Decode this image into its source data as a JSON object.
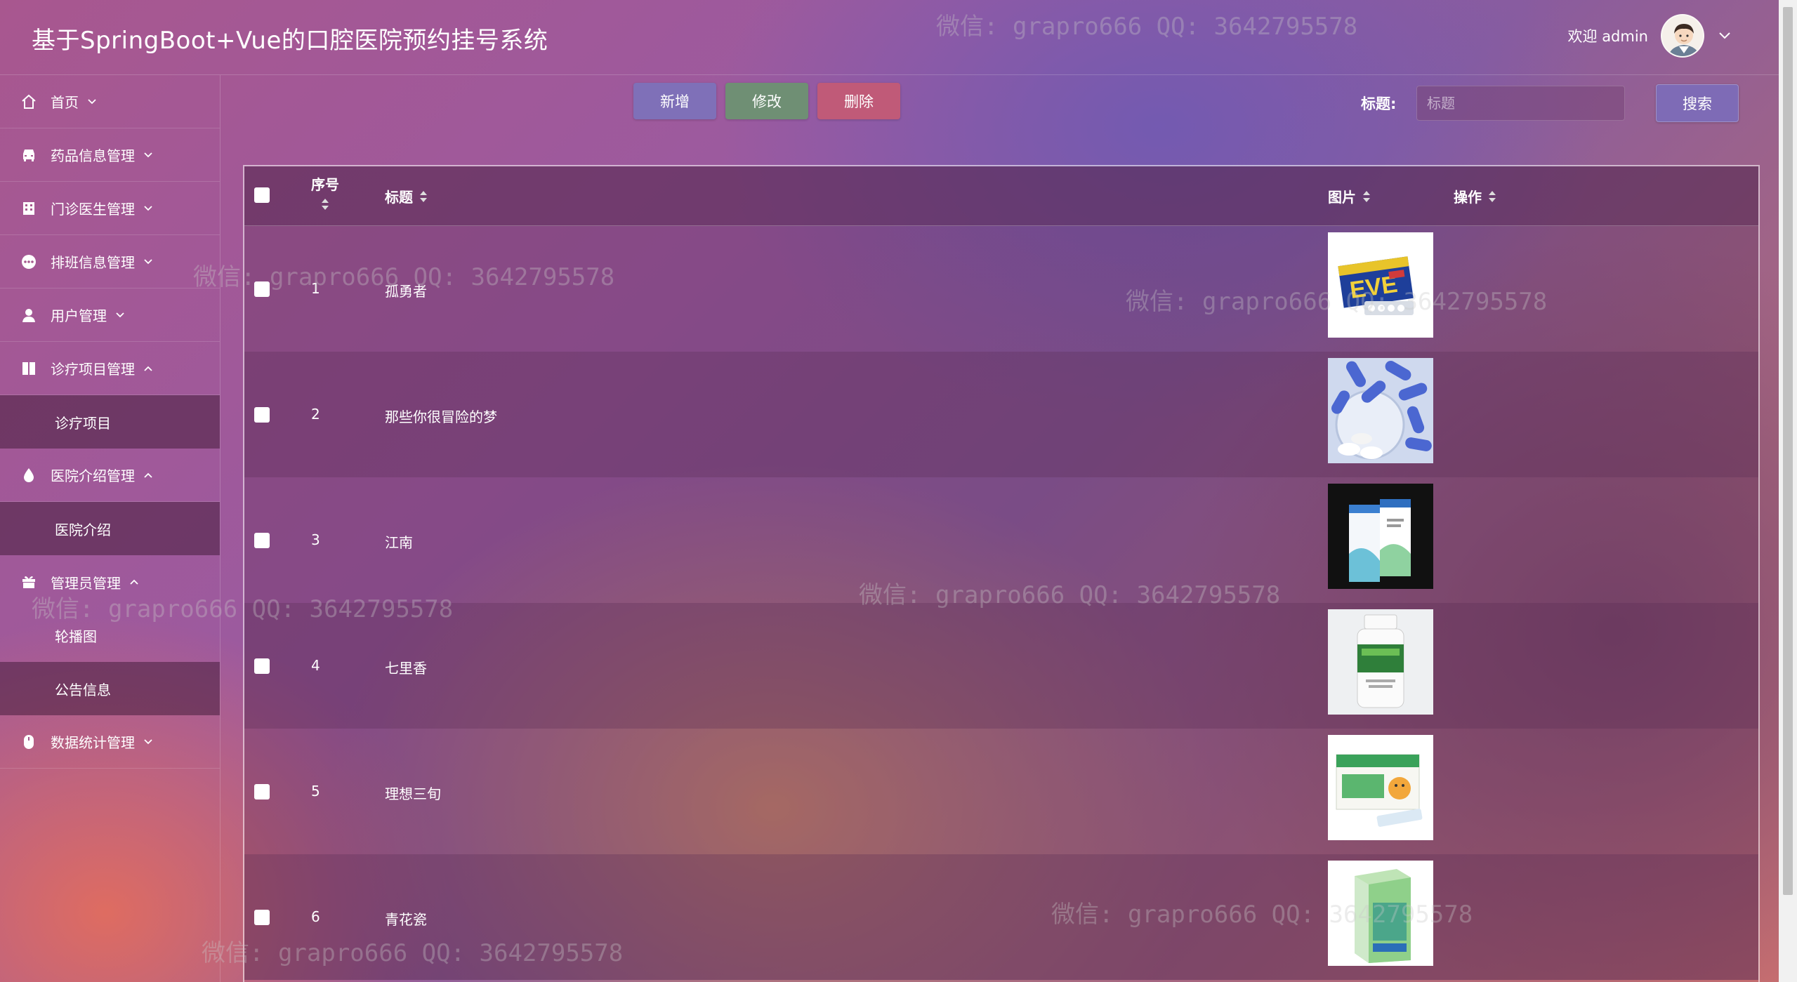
{
  "header": {
    "title": "基于SpringBoot+Vue的口腔医院预约挂号系统",
    "welcome": "欢迎 admin"
  },
  "sidebar": {
    "items": [
      {
        "label": "首页",
        "icon": "home-icon",
        "expanded": false
      },
      {
        "label": "药品信息管理",
        "icon": "car-icon",
        "expanded": false
      },
      {
        "label": "门诊医生管理",
        "icon": "building-icon",
        "expanded": false
      },
      {
        "label": "排班信息管理",
        "icon": "chat-dots-icon",
        "expanded": false
      },
      {
        "label": "用户管理",
        "icon": "user-icon",
        "expanded": false
      },
      {
        "label": "诊疗项目管理",
        "icon": "book-icon",
        "expanded": true,
        "children": [
          "诊疗项目"
        ]
      },
      {
        "label": "医院介绍管理",
        "icon": "drop-icon",
        "expanded": true,
        "children": [
          "医院介绍"
        ]
      },
      {
        "label": "管理员管理",
        "icon": "gift-icon",
        "expanded": true,
        "children": [
          "轮播图",
          "公告信息"
        ]
      },
      {
        "label": "数据统计管理",
        "icon": "mouse-icon",
        "expanded": false
      }
    ]
  },
  "toolbar": {
    "add_label": "新增",
    "edit_label": "修改",
    "delete_label": "删除",
    "search_label": "标题:",
    "search_placeholder": "标题",
    "search_button": "搜索"
  },
  "table": {
    "columns": [
      "序号",
      "标题",
      "图片",
      "操作"
    ],
    "rows": [
      {
        "index": "1",
        "title": "孤勇者",
        "image": "eve-box"
      },
      {
        "index": "2",
        "title": "那些你很冒险的梦",
        "image": "blue-capsules"
      },
      {
        "index": "3",
        "title": "江南",
        "image": "medicine-boxes"
      },
      {
        "index": "4",
        "title": "七里香",
        "image": "white-bottle"
      },
      {
        "index": "5",
        "title": "理想三旬",
        "image": "green-box"
      },
      {
        "index": "6",
        "title": "青花瓷",
        "image": "green-carton"
      }
    ]
  },
  "watermark": "微信: grapro666 QQ: 3642795578",
  "colors": {
    "add_button": "#7f70b8",
    "edit_button": "#6f8f74",
    "delete_button": "#c05a78",
    "search_button": "#7e6bb6"
  }
}
